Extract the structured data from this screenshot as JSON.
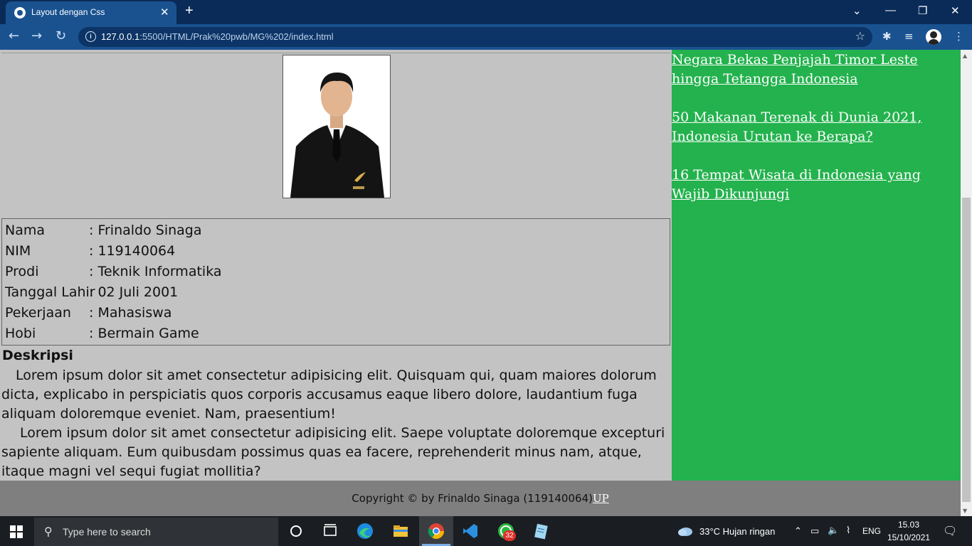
{
  "browser": {
    "tab_title": "Layout dengan Css",
    "tab_close": "✕",
    "new_tab": "+",
    "url_host": "127.0.0.1",
    "url_rest": ":5500/HTML/Prak%20pwb/MG%202/index.html",
    "window_controls": {
      "minimize": "—",
      "restore": "❐",
      "close": "✕",
      "dropdown": "⌄"
    },
    "icons": [
      "back-arrow-icon",
      "forward-arrow-icon",
      "reload-icon",
      "info-icon",
      "star-icon",
      "extensions-icon",
      "media-icon",
      "profile-avatar",
      "menu-icon"
    ]
  },
  "profile": {
    "rows": [
      {
        "key": "Nama",
        "value": ": Frinaldo Sinaga"
      },
      {
        "key": "NIM",
        "value": ": 119140064"
      },
      {
        "key": "Prodi",
        "value": ": Teknik Informatika"
      },
      {
        "key": "Tanggal Lahir",
        "value": ": 02 Juli 2001"
      },
      {
        "key": "Pekerjaan",
        "value": ": Mahasiswa"
      },
      {
        "key": "Hobi",
        "value": ": Bermain Game"
      }
    ]
  },
  "description": {
    "title": "Deskripsi",
    "paragraphs": [
      "Lorem ipsum dolor sit amet consectetur adipisicing elit. Quisquam qui, quam maiores dolorum dicta, explicabo in perspiciatis quos corporis accusamus eaque libero dolore, laudantium fuga aliquam doloremque eveniet. Nam, praesentium!",
      "Lorem ipsum dolor sit amet consectetur adipisicing elit. Saepe voluptate doloremque excepturi sapiente aliquam. Eum quibusdam possimus quas ea facere, reprehenderit minus nam, atque, itaque magni vel sequi fugiat mollitia?"
    ]
  },
  "sidebar": {
    "links": [
      "Negara Bekas Penjajah Timor Leste hingga Tetangga Indonesia",
      "50 Makanan Terenak di Dunia 2021, Indonesia Urutan ke Berapa?",
      "16 Tempat Wisata di Indonesia yang Wajib Dikunjungi"
    ]
  },
  "footer": {
    "copyright": "Copyright © by Frinaldo Sinaga (119140064)",
    "up_link": "UP"
  },
  "taskbar": {
    "search_placeholder": "Type here to search",
    "whatsapp_badge": "32",
    "weather": "33°C  Hujan ringan",
    "language": "ENG",
    "time": "15.03",
    "date": "15/10/2021"
  },
  "colors": {
    "chrome_dark": "#0a2b57",
    "chrome_toolbar": "#1a5290",
    "page_bg": "#c3c3c3",
    "sidebar_bg": "#23b24d",
    "footer_bg": "#7f7f7f"
  }
}
